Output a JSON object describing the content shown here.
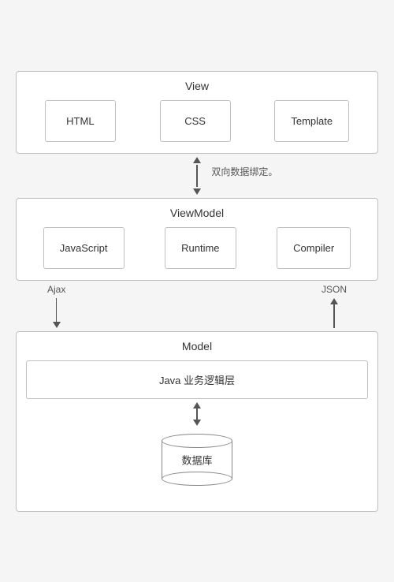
{
  "view": {
    "title": "View",
    "items": [
      "HTML",
      "CSS",
      "Template"
    ]
  },
  "binding_label": "双向数据绑定。",
  "viewmodel": {
    "title": "ViewModel",
    "items": [
      "JavaScript",
      "Runtime",
      "Compiler"
    ]
  },
  "ajax_label": "Ajax",
  "json_label": "JSON",
  "model": {
    "title": "Model",
    "java_label": "Java 业务逻辑层",
    "db_label": "数据库"
  }
}
